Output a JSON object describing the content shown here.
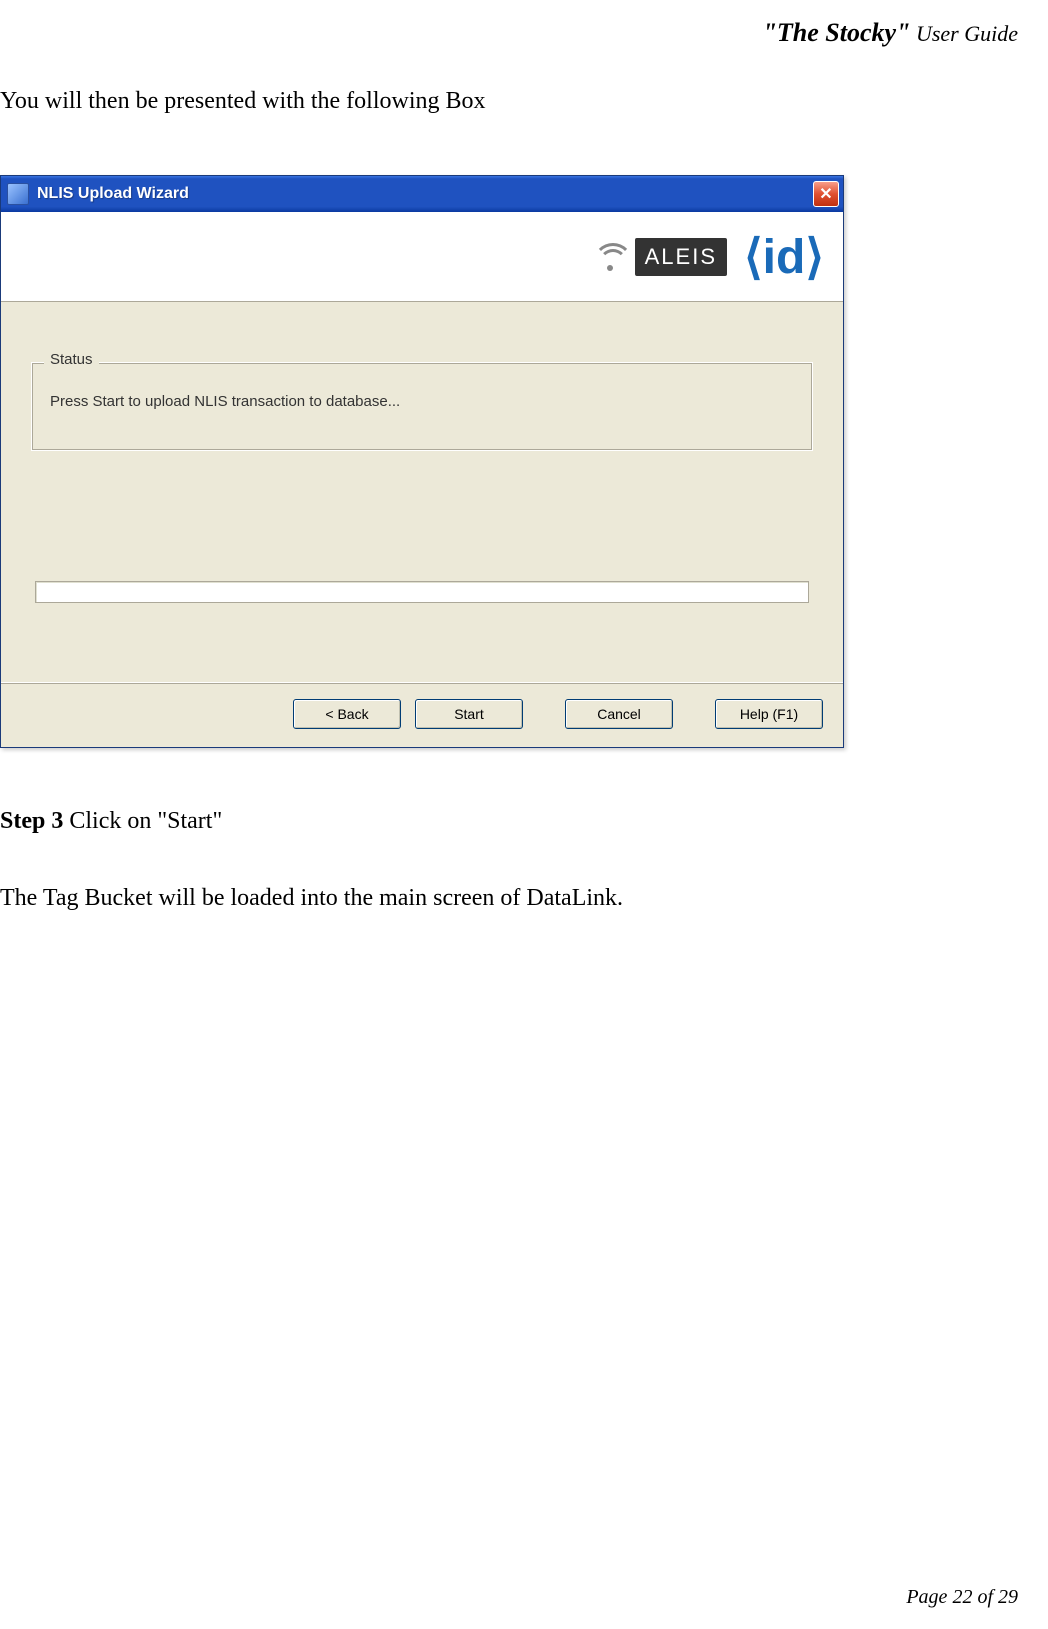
{
  "header": {
    "brand": "\"The Stocky\"",
    "subtitle": " User Guide"
  },
  "intro_text": "You will then be presented with the following Box",
  "dialog": {
    "title": "NLIS Upload Wizard",
    "logos": {
      "aleis_text": "ALEIS",
      "id_text": "⟨id⟩"
    },
    "status": {
      "legend": "Status",
      "message": "Press Start to upload NLIS transaction to database..."
    },
    "buttons": {
      "back": "< Back",
      "start": "Start",
      "cancel": "Cancel",
      "help": "Help (F1)"
    }
  },
  "step3": {
    "label": "Step 3",
    "text": " Click on \"Start\""
  },
  "result_text": "The Tag Bucket will be loaded into the main screen of DataLink.",
  "footer": "Page 22 of 29"
}
